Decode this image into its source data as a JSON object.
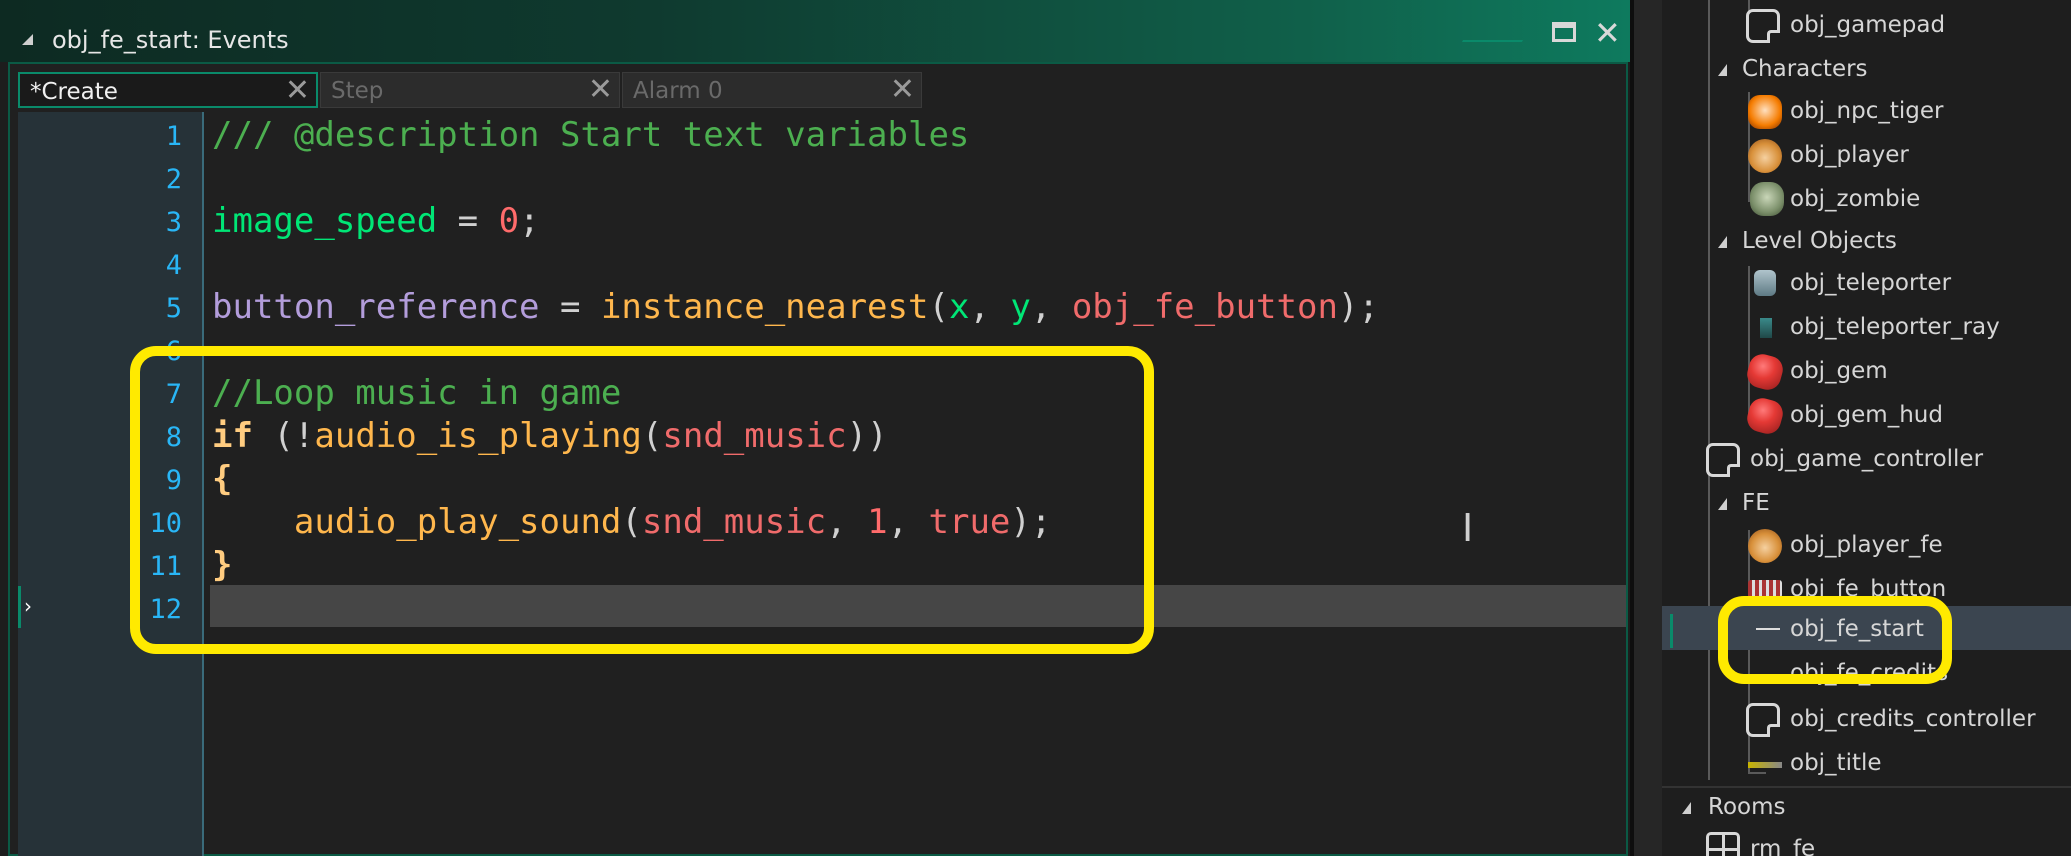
{
  "window": {
    "title": "obj_fe_start: Events"
  },
  "tabs": [
    {
      "label": "*Create",
      "active": true
    },
    {
      "label": "Step",
      "active": false
    },
    {
      "label": "Alarm 0",
      "active": false
    }
  ],
  "code": {
    "line_numbers": [
      "1",
      "2",
      "3",
      "4",
      "5",
      "6",
      "7",
      "8",
      "9",
      "10",
      "11",
      "12"
    ],
    "line1": "/// @description Start text variables",
    "line3": {
      "var": "image_speed",
      "op": " = ",
      "num": "0",
      "end": ";"
    },
    "line5": {
      "var": "button_reference",
      "op": " = ",
      "fn": "instance_nearest",
      "open": "(",
      "a1": "x",
      "c1": ", ",
      "a2": "y",
      "c2": ", ",
      "a3": "obj_fe_button",
      "close": ");"
    },
    "line7": "//Loop music in game",
    "line8": {
      "kw": "if",
      "p1": " (!",
      "fn": "audio_is_playing",
      "open": "(",
      "arg": "snd_music",
      "close": "))"
    },
    "line9": "{",
    "line10": {
      "indent": "    ",
      "fn": "audio_play_sound",
      "open": "(",
      "a1": "snd_music",
      "c1": ", ",
      "a2": "1",
      "c2": ", ",
      "a3": "true",
      "close": ");"
    },
    "line11": "}"
  },
  "tree": {
    "items": [
      {
        "label": "obj_gamepad",
        "icon": "blank-object-icon"
      },
      {
        "label": "Characters",
        "icon": "folder-open-icon"
      },
      {
        "label": "obj_npc_tiger",
        "icon": "tiger-sprite-icon"
      },
      {
        "label": "obj_player",
        "icon": "monkey-sprite-icon"
      },
      {
        "label": "obj_zombie",
        "icon": "zombie-sprite-icon"
      },
      {
        "label": "Level Objects",
        "icon": "folder-open-icon"
      },
      {
        "label": "obj_teleporter",
        "icon": "teleporter-sprite-icon"
      },
      {
        "label": "obj_teleporter_ray",
        "icon": "ray-sprite-icon"
      },
      {
        "label": "obj_gem",
        "icon": "gem-sprite-icon"
      },
      {
        "label": "obj_gem_hud",
        "icon": "gem-sprite-icon"
      },
      {
        "label": "obj_game_controller",
        "icon": "blank-object-icon"
      },
      {
        "label": "FE",
        "icon": "folder-open-icon"
      },
      {
        "label": "obj_player_fe",
        "icon": "monkey-sprite-icon"
      },
      {
        "label": "obj_fe_button",
        "icon": "button-sprite-icon"
      },
      {
        "label": "obj_fe_start",
        "icon": "start-sprite-icon",
        "selected": true
      },
      {
        "label": "obj_fe_credits",
        "icon": "none"
      },
      {
        "label": "obj_credits_controller",
        "icon": "blank-object-icon"
      },
      {
        "label": "obj_title",
        "icon": "title-sprite-icon"
      },
      {
        "label": "Rooms",
        "icon": "folder-open-icon"
      },
      {
        "label": "rm_fe",
        "icon": "room-icon"
      }
    ]
  },
  "colors": {
    "highlight": "#ffea00",
    "accent": "#0a8a6a"
  }
}
